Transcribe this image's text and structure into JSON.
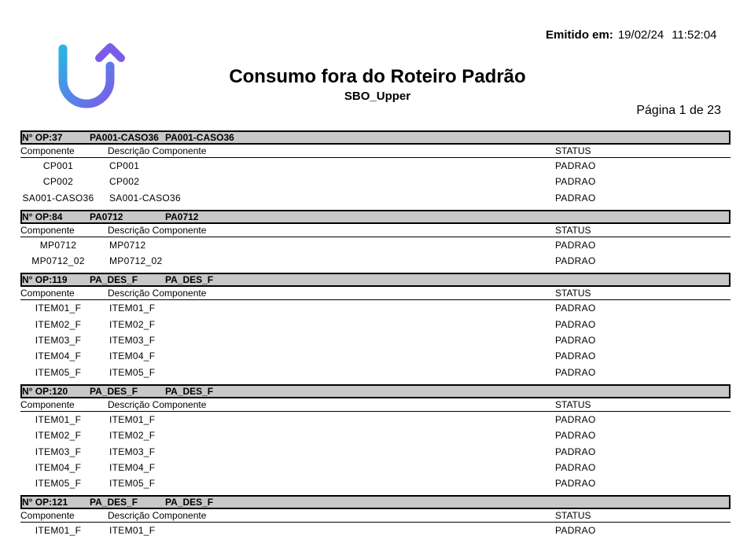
{
  "header": {
    "emitido_label": "Emitido em:",
    "emitido_date": "19/02/24",
    "emitido_time": "11:52:04",
    "title": "Consumo fora do Roteiro Padrão",
    "subtitle": "SBO_Upper",
    "page": "Página 1 de 23"
  },
  "logo": {
    "icon": "upper-logo-icon",
    "color_from": "#2ab3e6",
    "color_to": "#7b5ce8"
  },
  "columns": {
    "componente": "Componente",
    "descricao": "Descrição Componente",
    "status": "STATUS"
  },
  "sections": [
    {
      "op": "N° OP:37",
      "code": "PA001-CASO36",
      "desc": "PA001-CASO36",
      "rows": [
        {
          "comp": "CP001",
          "desc": "CP001",
          "status": "PADRAO"
        },
        {
          "comp": "CP002",
          "desc": "CP002",
          "status": "PADRAO"
        },
        {
          "comp": "SA001-CASO36",
          "desc": "SA001-CASO36",
          "status": "PADRAO"
        }
      ]
    },
    {
      "op": "N° OP:84",
      "code": "PA0712",
      "desc": "PA0712",
      "rows": [
        {
          "comp": "MP0712",
          "desc": "MP0712",
          "status": "PADRAO"
        },
        {
          "comp": "MP0712_02",
          "desc": "MP0712_02",
          "status": "PADRAO"
        }
      ]
    },
    {
      "op": "N° OP:119",
      "code": "PA_DES_F",
      "desc": "PA_DES_F",
      "rows": [
        {
          "comp": "ITEM01_F",
          "desc": "ITEM01_F",
          "status": "PADRAO"
        },
        {
          "comp": "ITEM02_F",
          "desc": "ITEM02_F",
          "status": "PADRAO"
        },
        {
          "comp": "ITEM03_F",
          "desc": "ITEM03_F",
          "status": "PADRAO"
        },
        {
          "comp": "ITEM04_F",
          "desc": "ITEM04_F",
          "status": "PADRAO"
        },
        {
          "comp": "ITEM05_F",
          "desc": "ITEM05_F",
          "status": "PADRAO"
        }
      ]
    },
    {
      "op": "N° OP:120",
      "code": "PA_DES_F",
      "desc": "PA_DES_F",
      "rows": [
        {
          "comp": "ITEM01_F",
          "desc": "ITEM01_F",
          "status": "PADRAO"
        },
        {
          "comp": "ITEM02_F",
          "desc": "ITEM02_F",
          "status": "PADRAO"
        },
        {
          "comp": "ITEM03_F",
          "desc": "ITEM03_F",
          "status": "PADRAO"
        },
        {
          "comp": "ITEM04_F",
          "desc": "ITEM04_F",
          "status": "PADRAO"
        },
        {
          "comp": "ITEM05_F",
          "desc": "ITEM05_F",
          "status": "PADRAO"
        }
      ]
    },
    {
      "op": "N° OP:121",
      "code": "PA_DES_F",
      "desc": "PA_DES_F",
      "rows": [
        {
          "comp": "ITEM01_F",
          "desc": "ITEM01_F",
          "status": "PADRAO"
        }
      ]
    }
  ]
}
